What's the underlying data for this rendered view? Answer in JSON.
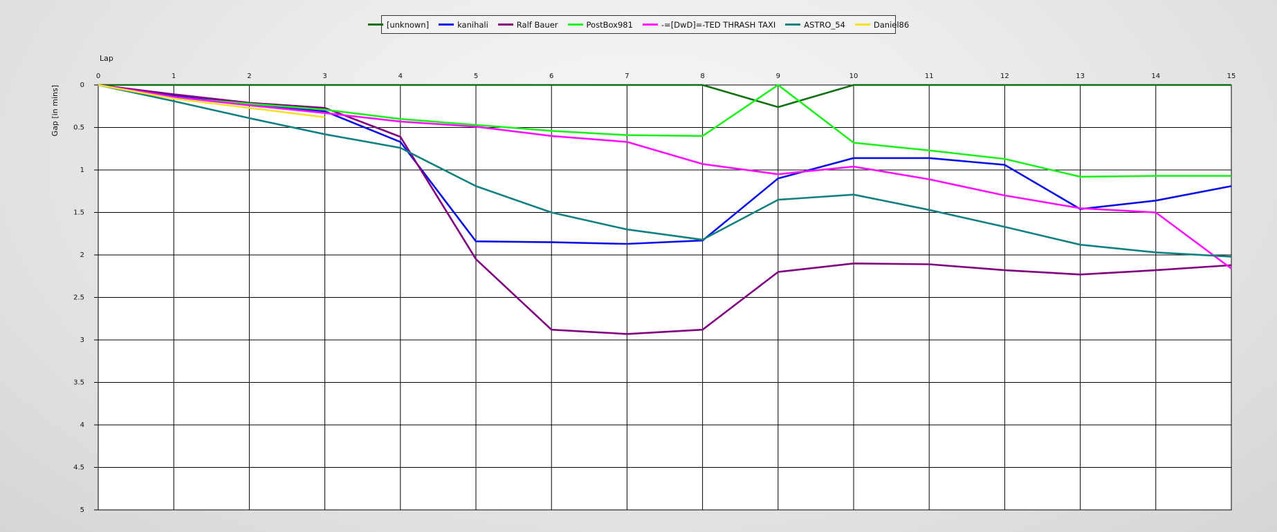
{
  "chart_data": {
    "type": "line",
    "title": "",
    "xlabel": "Lap",
    "ylabel": "Gap [in mins]",
    "x_ticks": [
      "0",
      "1",
      "2",
      "3",
      "4",
      "5",
      "6",
      "7",
      "8",
      "9",
      "10",
      "11",
      "12",
      "13",
      "14",
      "15"
    ],
    "y_ticks": [
      "0",
      "0.5",
      "1",
      "1.5",
      "2",
      "2.5",
      "3",
      "3.5",
      "4",
      "4.5",
      "5"
    ],
    "xlim": [
      0,
      15
    ],
    "ylim": [
      0,
      5
    ],
    "y_inverted": true,
    "x_axis_position": "top",
    "grid": true,
    "legend_placement": "top",
    "series": [
      {
        "name": "[unknown]",
        "color": "#107010",
        "x": [
          0,
          1,
          2,
          3,
          4,
          5,
          6,
          7,
          8,
          9,
          10,
          11,
          12,
          13,
          14,
          15
        ],
        "values": [
          0,
          0,
          0,
          0,
          0,
          0,
          0,
          0,
          0,
          0.26,
          0,
          0,
          0,
          0,
          0,
          0
        ]
      },
      {
        "name": "kanihali",
        "color": "#0a10e6",
        "x": [
          0,
          1,
          2,
          3,
          4,
          5,
          6,
          7,
          8,
          9,
          10,
          11,
          12,
          13,
          14,
          15
        ],
        "values": [
          0,
          0.13,
          0.23,
          0.31,
          0.67,
          1.84,
          1.85,
          1.87,
          1.83,
          1.1,
          0.86,
          0.86,
          0.94,
          1.46,
          1.36,
          1.19
        ]
      },
      {
        "name": "Ralf Bauer",
        "color": "#800080",
        "x": [
          0,
          1,
          2,
          3,
          4,
          5,
          6,
          7,
          8,
          9,
          10,
          11,
          12,
          13,
          14,
          15
        ],
        "values": [
          0,
          0.11,
          0.21,
          0.27,
          0.61,
          2.05,
          2.88,
          2.93,
          2.88,
          2.2,
          2.1,
          2.11,
          2.18,
          2.23,
          2.18,
          2.12
        ]
      },
      {
        "name": "PostBox981",
        "color": "#1ef01e",
        "x": [
          0,
          1,
          2,
          3,
          4,
          5,
          6,
          7,
          8,
          9,
          10,
          11,
          12,
          13,
          14,
          15
        ],
        "values": [
          0,
          0.15,
          0.22,
          0.29,
          0.4,
          0.47,
          0.54,
          0.59,
          0.6,
          0,
          0.68,
          0.77,
          0.87,
          1.08,
          1.07,
          1.07
        ]
      },
      {
        "name": "-=[DwD]=-TED THRASH TAXI",
        "color": "#ff10ff",
        "x": [
          0,
          1,
          2,
          3,
          4,
          5,
          6,
          7,
          8,
          9,
          10,
          11,
          12,
          13,
          14,
          15
        ],
        "values": [
          0,
          0.14,
          0.24,
          0.33,
          0.43,
          0.49,
          0.6,
          0.67,
          0.93,
          1.05,
          0.96,
          1.11,
          1.3,
          1.45,
          1.5,
          2.16
        ]
      },
      {
        "name": "ASTRO_54",
        "color": "#108080",
        "x": [
          0,
          1,
          2,
          3,
          4,
          5,
          6,
          7,
          8,
          9,
          10,
          11,
          12,
          13,
          14,
          15
        ],
        "values": [
          0,
          0.19,
          0.39,
          0.58,
          0.74,
          1.19,
          1.5,
          1.7,
          1.82,
          1.35,
          1.29,
          1.47,
          1.67,
          1.88,
          1.97,
          2.02
        ]
      },
      {
        "name": "Daniel86",
        "color": "#f5e02a",
        "x": [
          0,
          1,
          2,
          3
        ],
        "values": [
          0,
          0.16,
          0.27,
          0.38
        ]
      }
    ]
  }
}
